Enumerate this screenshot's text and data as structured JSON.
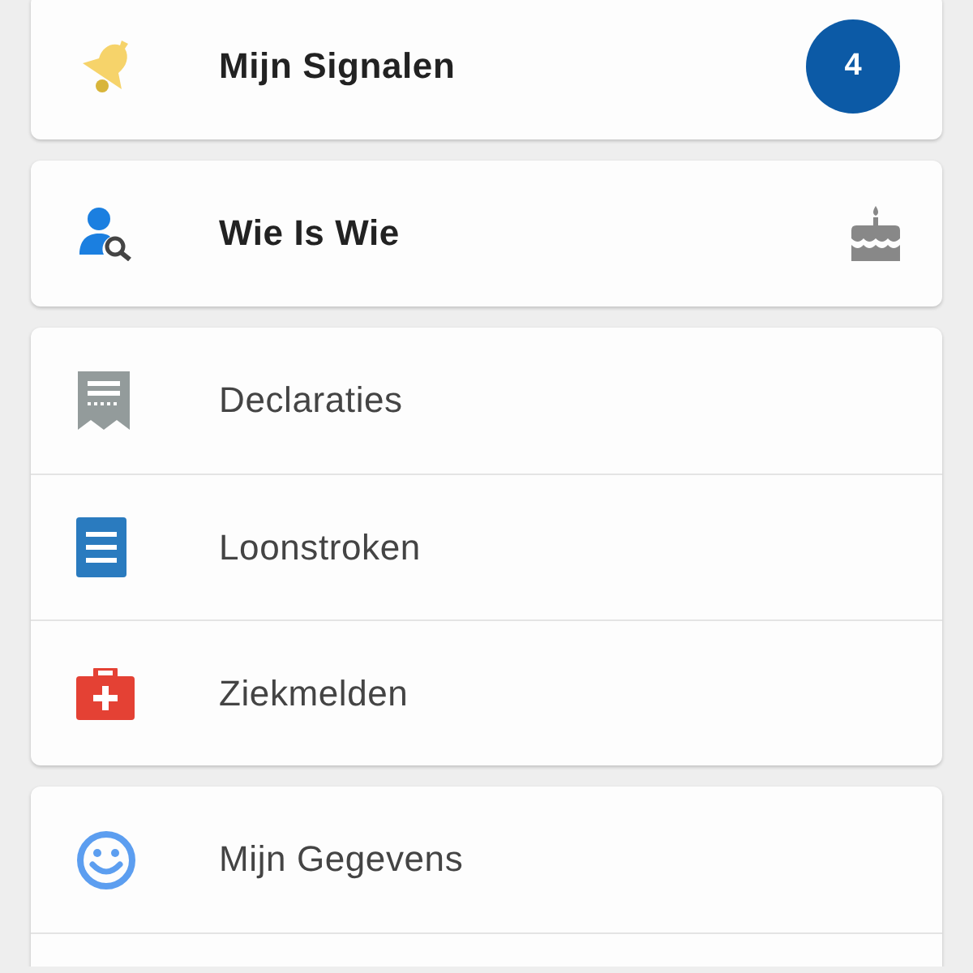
{
  "groups": [
    {
      "items": [
        {
          "kind": "bell",
          "label": "Mijn Signalen",
          "badge": "4"
        }
      ]
    },
    {
      "items": [
        {
          "kind": "person-search",
          "label": "Wie Is Wie"
        }
      ]
    },
    {
      "items": [
        {
          "kind": "receipt",
          "label": "Declaraties"
        },
        {
          "kind": "document",
          "label": "Loonstroken"
        },
        {
          "kind": "medkit",
          "label": "Ziekmelden"
        }
      ]
    },
    {
      "items": [
        {
          "kind": "smiley",
          "label": "Mijn Gegevens"
        },
        {
          "kind": "blank"
        }
      ]
    }
  ]
}
